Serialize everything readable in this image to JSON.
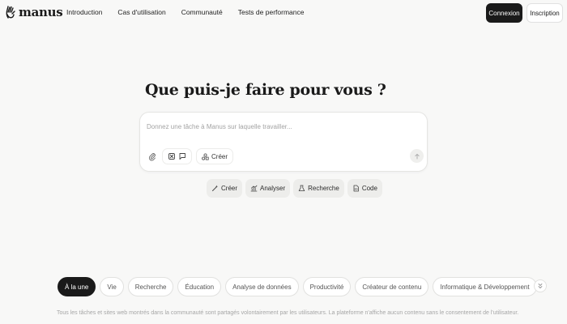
{
  "header": {
    "logo_text": "manus",
    "nav": [
      "Introduction",
      "Cas d'utilisation",
      "Communauté",
      "Tests de performance"
    ],
    "login_label": "Connexion",
    "signup_label": "Inscription"
  },
  "hero": {
    "title": "Que puis-je faire pour vous ?",
    "input_placeholder": "Donnez une tâche à Manus sur laquelle travailler...",
    "input_value": "",
    "create_label": "Créer",
    "quick_actions": [
      {
        "label": "Créer",
        "icon": "wand-icon"
      },
      {
        "label": "Analyser",
        "icon": "chart-icon"
      },
      {
        "label": "Recherche",
        "icon": "flask-icon"
      },
      {
        "label": "Code",
        "icon": "file-code-icon"
      }
    ]
  },
  "categories": {
    "items": [
      "À la une",
      "Vie",
      "Recherche",
      "Éducation",
      "Analyse de données",
      "Productivité",
      "Créateur de contenu",
      "Informatique & Développement"
    ],
    "active_index": 0
  },
  "footer": {
    "note": "Tous les tâches et sites web montrés dans la communauté sont partagés volontairement par les utilisateurs. La plateforme n'affiche aucun contenu sans le consentement de l'utilisateur."
  },
  "colors": {
    "background": "#f8f8f7",
    "primary_dark": "#1a1a1a",
    "chip_bg": "#ededeb"
  }
}
